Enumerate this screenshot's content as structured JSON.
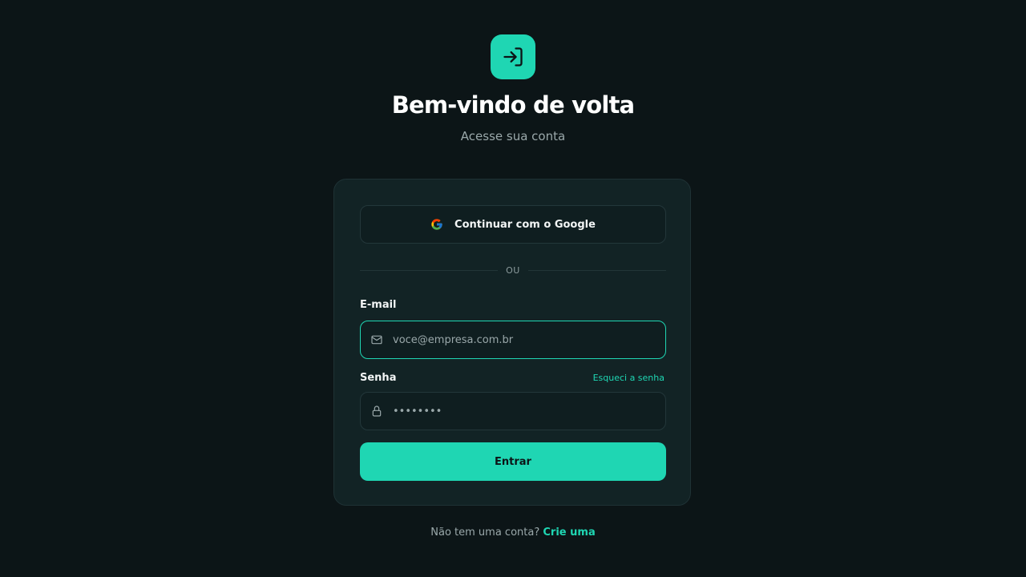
{
  "header": {
    "logo_icon": "login-arrow-icon",
    "title": "Bem-vindo de volta",
    "subtitle": "Acesse sua conta"
  },
  "card": {
    "google_button": {
      "icon": "google-icon",
      "label": "Continuar com o Google"
    },
    "divider_text": "OU",
    "email": {
      "label": "E-mail",
      "icon": "mail-icon",
      "value": "",
      "placeholder": "voce@empresa.com.br"
    },
    "password": {
      "label": "Senha",
      "forgot_label": "Esqueci a senha",
      "icon": "lock-icon",
      "value": "",
      "placeholder": "••••••••"
    },
    "submit_label": "Entrar"
  },
  "footer": {
    "prompt": "Não tem uma conta?",
    "link": "Crie uma"
  },
  "colors": {
    "background": "#0c1517",
    "card": "#122325",
    "accent": "#1fd6b3",
    "muted_text": "#9aa8aa"
  }
}
